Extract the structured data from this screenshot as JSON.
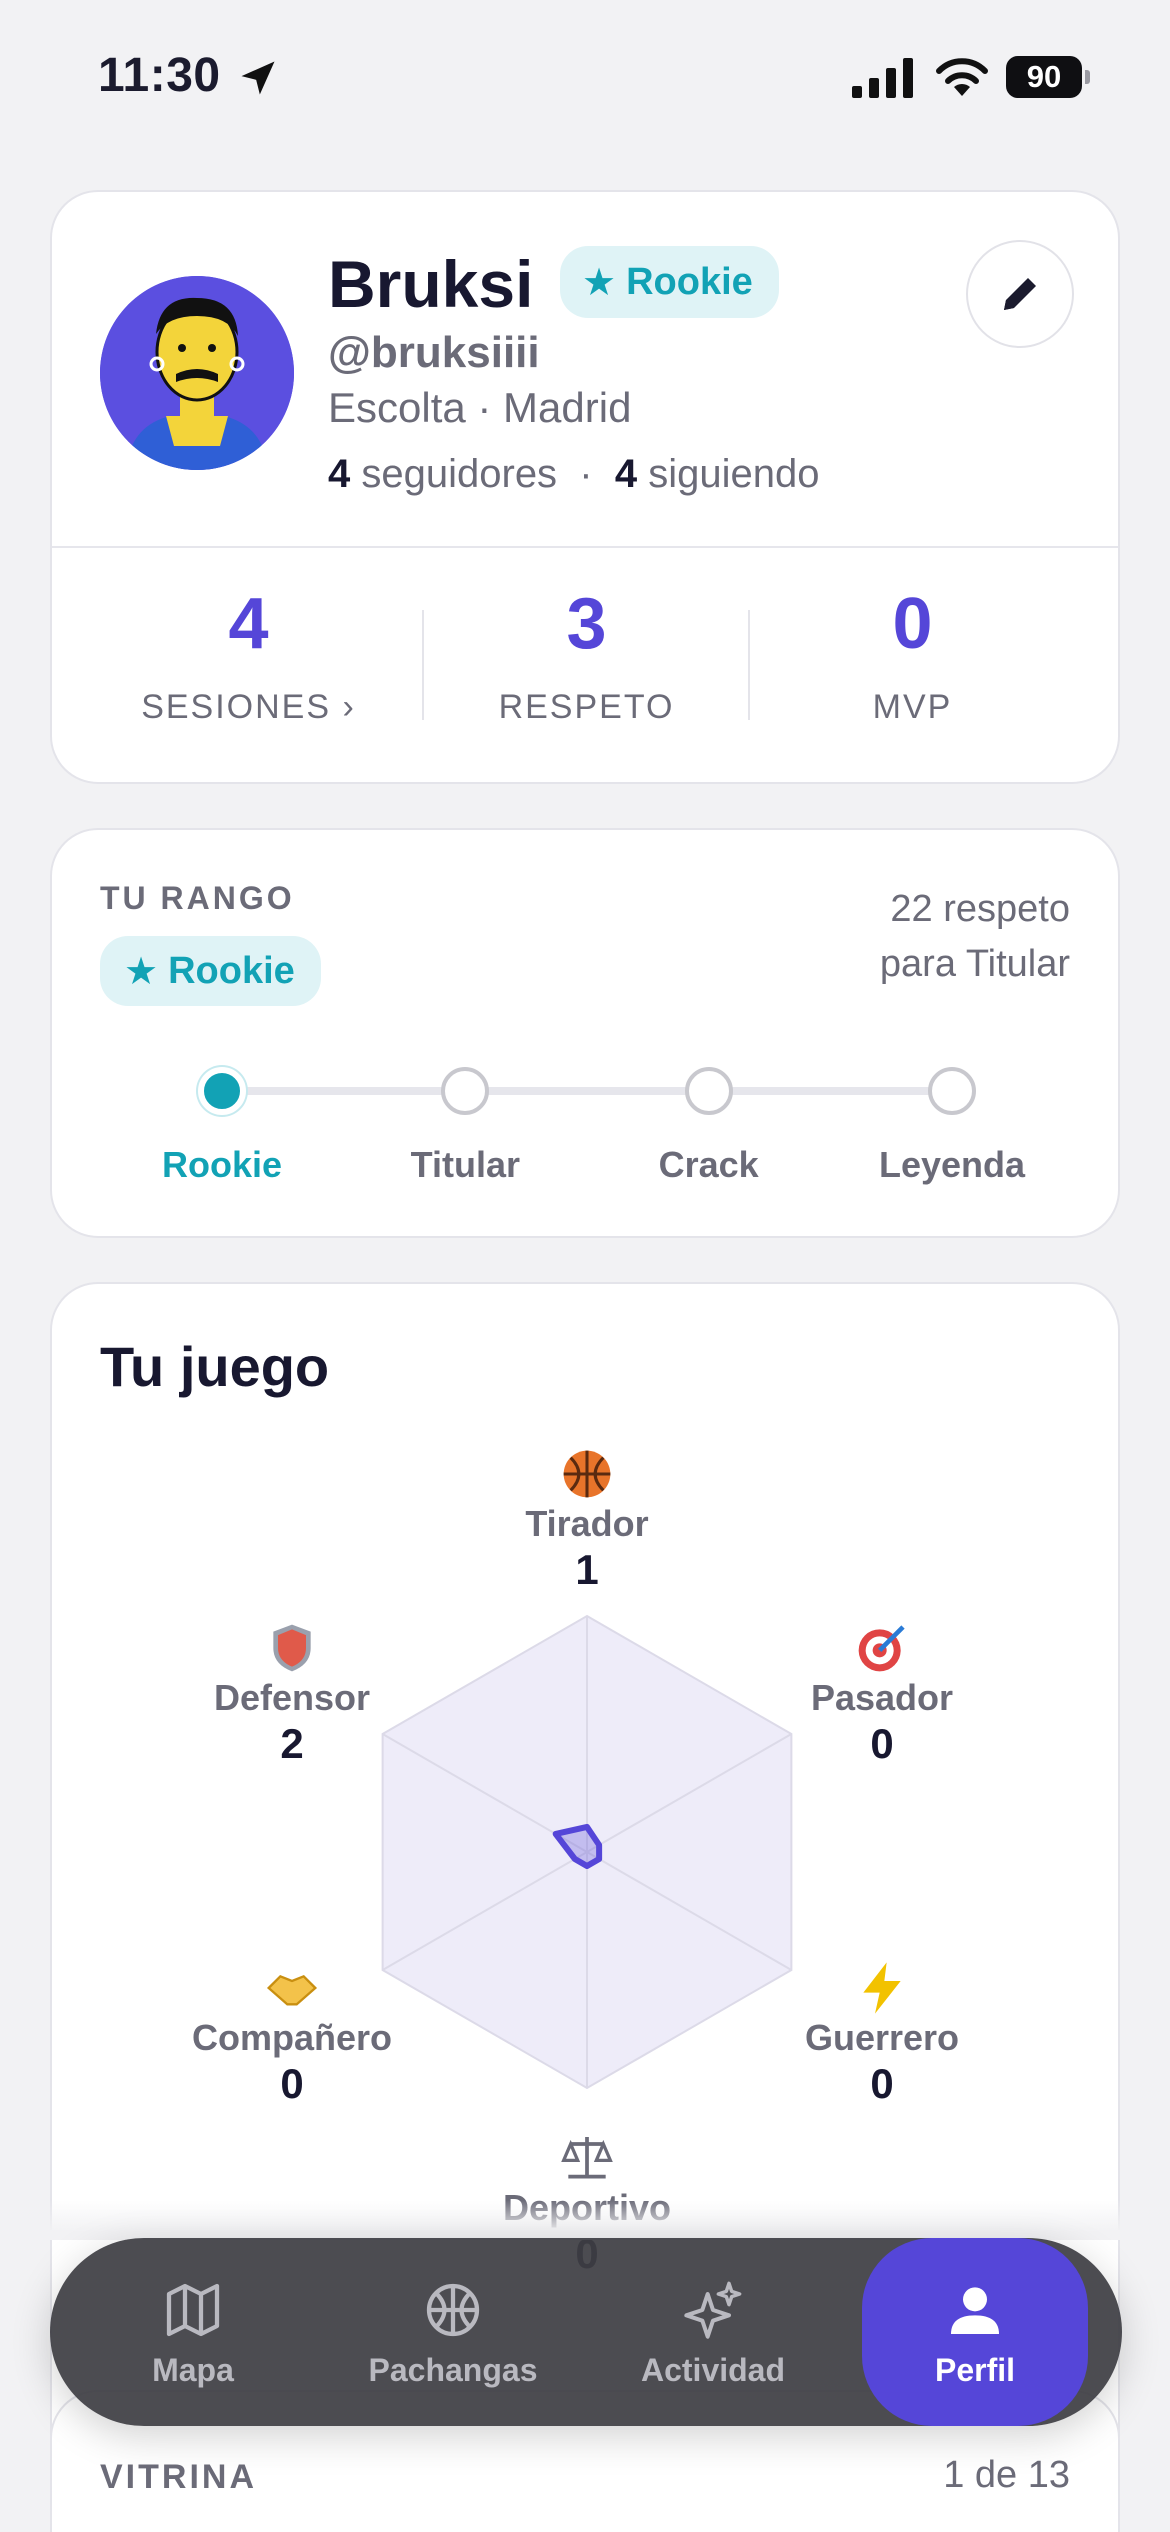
{
  "status_bar": {
    "time": "11:30",
    "battery": "90"
  },
  "profile": {
    "name": "Bruksi",
    "rank": "Rookie",
    "handle": "@bruksiiii",
    "role_city": "Escolta · Madrid",
    "followers_count": "4",
    "followers_label": "seguidores",
    "following_count": "4",
    "following_label": "siguiendo",
    "follow_separator": "·"
  },
  "stats": [
    {
      "value": "4",
      "label": "SESIONES ›"
    },
    {
      "value": "3",
      "label": "RESPETO"
    },
    {
      "value": "0",
      "label": "MVP"
    }
  ],
  "rank_card": {
    "title": "TU RANGO",
    "current": "Rookie",
    "need_line1": "22 respeto",
    "need_line2": "para Titular",
    "steps": [
      "Rookie",
      "Titular",
      "Crack",
      "Leyenda"
    ],
    "progress_fraction": 0.0
  },
  "game": {
    "title": "Tu juego",
    "attributes": [
      {
        "icon": "basketball-icon",
        "label": "Tirador",
        "value": 1
      },
      {
        "icon": "target-icon",
        "label": "Pasador",
        "value": 0
      },
      {
        "icon": "lightning-icon",
        "label": "Guerrero",
        "value": 0
      },
      {
        "icon": "scales-icon",
        "label": "Deportivo",
        "value": 0
      },
      {
        "icon": "handshake-icon",
        "label": "Compañero",
        "value": 0
      },
      {
        "icon": "shield-icon",
        "label": "Defensor",
        "value": 2
      }
    ]
  },
  "vitrina": {
    "title": "VITRINA",
    "count": "1 de 13"
  },
  "tabs": [
    {
      "icon": "map-icon",
      "label": "Mapa"
    },
    {
      "icon": "basketball-icon",
      "label": "Pachangas"
    },
    {
      "icon": "sparkles-icon",
      "label": "Actividad"
    },
    {
      "icon": "person-icon",
      "label": "Perfil",
      "active": true
    }
  ],
  "colors": {
    "accent": "#5546d8",
    "rank": "#12a2b5",
    "background": "#f2f2f4"
  }
}
